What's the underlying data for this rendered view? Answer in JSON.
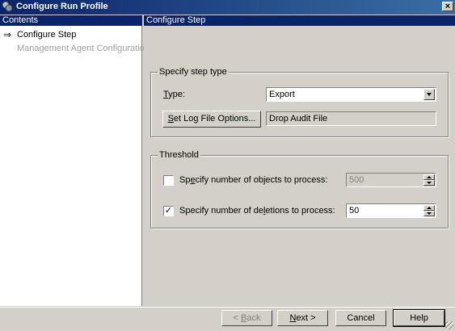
{
  "window": {
    "title": "Configure Run Profile",
    "close_glyph": "×"
  },
  "left_header": "Contents",
  "right_header": "Configure Step",
  "nav": {
    "items": [
      {
        "label": "Configure Step",
        "current": true
      },
      {
        "label": "Management Agent Configuration",
        "current": false
      }
    ]
  },
  "step_type": {
    "group_title": "Specify step type",
    "type_label": "Type:",
    "type_value": "Export",
    "log_button": "Set Log File Options...",
    "log_value": "Drop Audit File"
  },
  "threshold": {
    "group_title": "Threshold",
    "objects_label": "Specify number of objects to process:",
    "objects_checked": false,
    "objects_value": "500",
    "deletions_label": "Specify number of deletions to process:",
    "deletions_checked": true,
    "deletions_value": "50"
  },
  "buttons": {
    "back": "< Back",
    "next": "Next >",
    "cancel": "Cancel",
    "help": "Help"
  },
  "glyphs": {
    "arrow": "⇒",
    "check": "✓"
  }
}
